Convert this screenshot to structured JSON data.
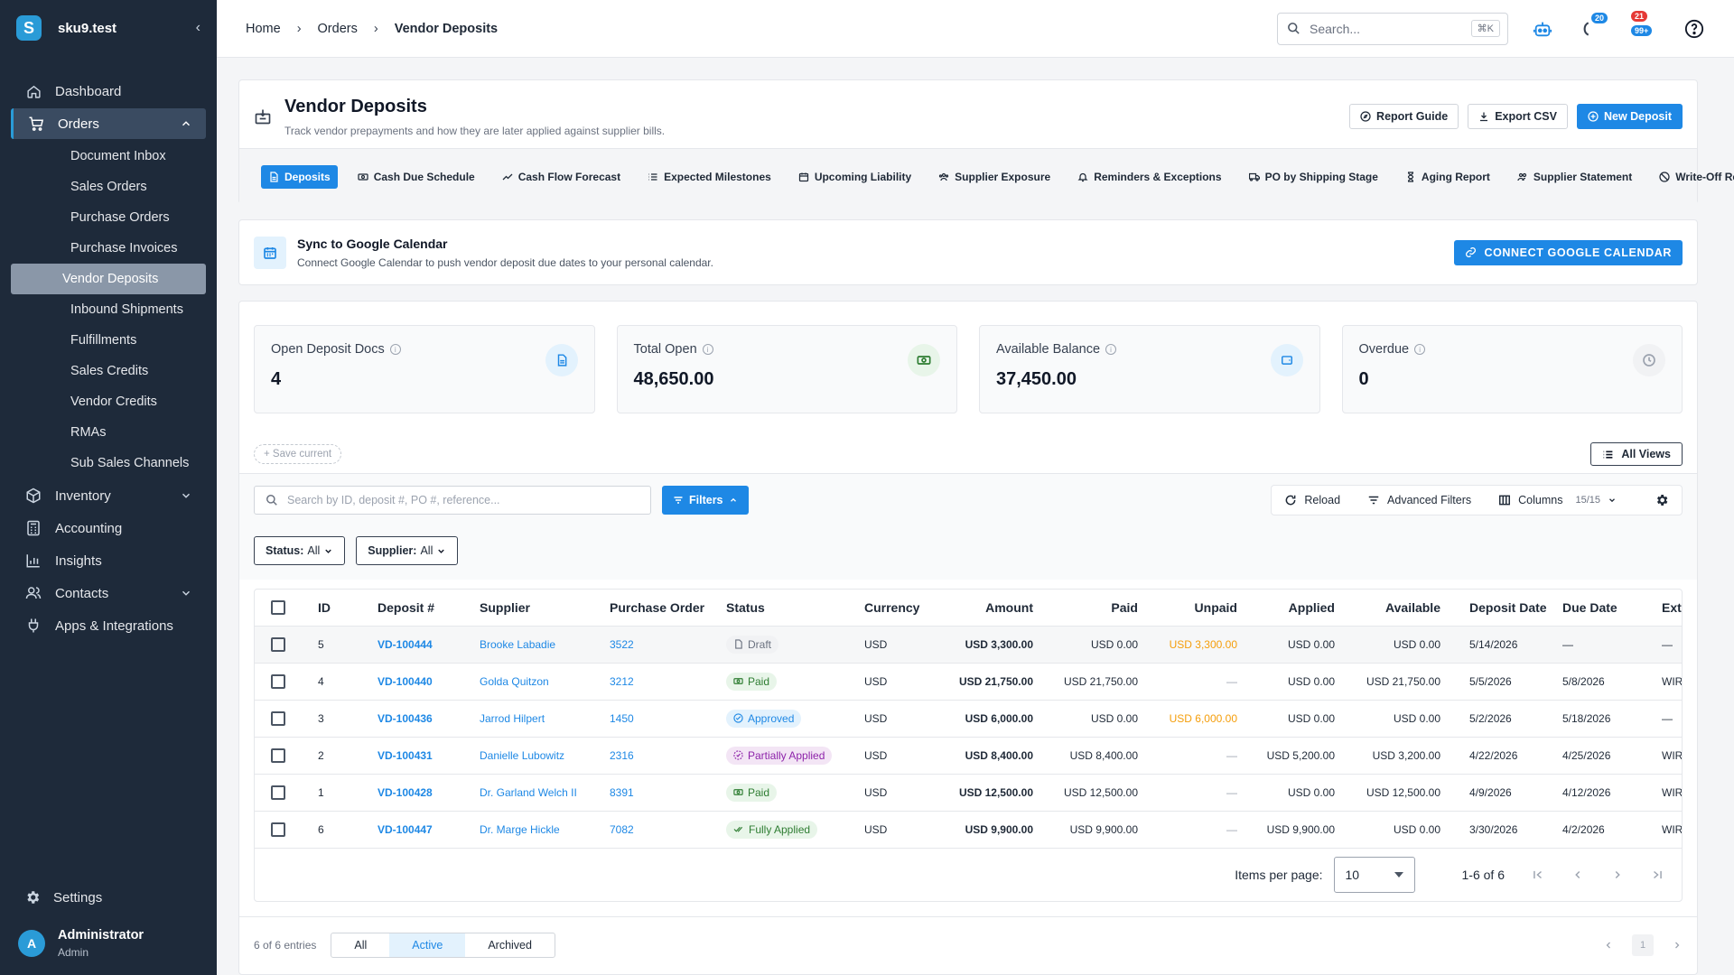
{
  "sidebar": {
    "brand": "sku9.test",
    "nav": {
      "dashboard": "Dashboard",
      "orders": "Orders",
      "inventory": "Inventory",
      "accounting": "Accounting",
      "insights": "Insights",
      "contacts": "Contacts",
      "apps": "Apps & Integrations"
    },
    "orders_sub": [
      "Document Inbox",
      "Sales Orders",
      "Purchase Orders",
      "Purchase Invoices",
      "Vendor Deposits",
      "Inbound Shipments",
      "Fulfillments",
      "Sales Credits",
      "Vendor Credits",
      "RMAs",
      "Sub Sales Channels"
    ],
    "settings": "Settings",
    "user": {
      "initial": "A",
      "name": "Administrator",
      "role": "Admin"
    }
  },
  "topbar": {
    "breadcrumb": [
      "Home",
      "Orders",
      "Vendor Deposits"
    ],
    "search_placeholder": "Search...",
    "search_shortcut": "⌘K",
    "badge_1": "20",
    "badge_2a": "21",
    "badge_2b": "99+"
  },
  "page": {
    "title": "Vendor Deposits",
    "subtitle": "Track vendor prepayments and how they are later applied against supplier bills.",
    "actions": {
      "guide": "Report Guide",
      "export": "Export CSV",
      "new": "New Deposit"
    },
    "tabs": [
      "Deposits",
      "Cash Due Schedule",
      "Cash Flow Forecast",
      "Expected Milestones",
      "Upcoming Liability",
      "Supplier Exposure",
      "Reminders & Exceptions",
      "PO by Shipping Stage",
      "Aging Report",
      "Supplier Statement",
      "Write-Off Report"
    ]
  },
  "sync": {
    "title": "Sync to Google Calendar",
    "subtitle": "Connect Google Calendar to push vendor deposit due dates to your personal calendar.",
    "button": "CONNECT GOOGLE CALENDAR"
  },
  "stats": [
    {
      "label": "Open Deposit Docs",
      "value": "4",
      "color": "#1e88e5",
      "bg": "#e3f2fd"
    },
    {
      "label": "Total Open",
      "value": "48,650.00",
      "color": "#2e7d32",
      "bg": "#e8f5e9"
    },
    {
      "label": "Available Balance",
      "value": "37,450.00",
      "color": "#1e88e5",
      "bg": "#e3f2fd"
    },
    {
      "label": "Overdue",
      "value": "0",
      "color": "#9ca3af",
      "bg": "#f1f2f4"
    }
  ],
  "views": {
    "save_current": "Save current",
    "all_views": "All Views"
  },
  "filters": {
    "search_placeholder": "Search by ID, deposit #, PO #, reference...",
    "filters_btn": "Filters",
    "reload": "Reload",
    "advanced": "Advanced Filters",
    "columns": "Columns",
    "columns_count": "15/15",
    "status_label": "Status:",
    "status_value": "All",
    "supplier_label": "Supplier:",
    "supplier_value": "All"
  },
  "table": {
    "headers": [
      "ID",
      "Deposit #",
      "Supplier",
      "Purchase Order",
      "Status",
      "Currency",
      "Amount",
      "Paid",
      "Unpaid",
      "Applied",
      "Available",
      "Deposit Date",
      "Due Date",
      "Ext."
    ],
    "rows": [
      {
        "id": "5",
        "deposit": "VD-100444",
        "supplier": "Brooke Labadie",
        "po": "3522",
        "status": "Draft",
        "status_kind": "draft",
        "currency": "USD",
        "amount": "USD 3,300.00",
        "paid": "USD 0.00",
        "unpaid": "USD 3,300.00",
        "applied": "USD 0.00",
        "available": "USD 0.00",
        "deposit_date": "5/14/2026",
        "due_date": "—",
        "ext": "—"
      },
      {
        "id": "4",
        "deposit": "VD-100440",
        "supplier": "Golda Quitzon",
        "po": "3212",
        "status": "Paid",
        "status_kind": "paid",
        "currency": "USD",
        "amount": "USD 21,750.00",
        "paid": "USD 21,750.00",
        "unpaid": "—",
        "applied": "USD 0.00",
        "available": "USD 21,750.00",
        "deposit_date": "5/5/2026",
        "due_date": "5/8/2026",
        "ext": "WIR"
      },
      {
        "id": "3",
        "deposit": "VD-100436",
        "supplier": "Jarrod Hilpert",
        "po": "1450",
        "status": "Approved",
        "status_kind": "approved",
        "currency": "USD",
        "amount": "USD 6,000.00",
        "paid": "USD 0.00",
        "unpaid": "USD 6,000.00",
        "applied": "USD 0.00",
        "available": "USD 0.00",
        "deposit_date": "5/2/2026",
        "due_date": "5/18/2026",
        "ext": "—"
      },
      {
        "id": "2",
        "deposit": "VD-100431",
        "supplier": "Danielle Lubowitz",
        "po": "2316",
        "status": "Partially Applied",
        "status_kind": "partial",
        "currency": "USD",
        "amount": "USD 8,400.00",
        "paid": "USD 8,400.00",
        "unpaid": "—",
        "applied": "USD 5,200.00",
        "available": "USD 3,200.00",
        "deposit_date": "4/22/2026",
        "due_date": "4/25/2026",
        "ext": "WIR"
      },
      {
        "id": "1",
        "deposit": "VD-100428",
        "supplier": "Dr. Garland Welch II",
        "po": "8391",
        "status": "Paid",
        "status_kind": "paid",
        "currency": "USD",
        "amount": "USD 12,500.00",
        "paid": "USD 12,500.00",
        "unpaid": "—",
        "applied": "USD 0.00",
        "available": "USD 12,500.00",
        "deposit_date": "4/9/2026",
        "due_date": "4/12/2026",
        "ext": "WIR"
      },
      {
        "id": "6",
        "deposit": "VD-100447",
        "supplier": "Dr. Marge Hickle",
        "po": "7082",
        "status": "Fully Applied",
        "status_kind": "full",
        "currency": "USD",
        "amount": "USD 9,900.00",
        "paid": "USD 9,900.00",
        "unpaid": "—",
        "applied": "USD 9,900.00",
        "available": "USD 0.00",
        "deposit_date": "3/30/2026",
        "due_date": "4/2/2026",
        "ext": "WIR"
      }
    ]
  },
  "pager": {
    "items_per_page_label": "Items per page:",
    "items_per_page": "10",
    "range": "1-6 of 6"
  },
  "footer": {
    "entries": "6 of 6 entries",
    "segments": [
      "All",
      "Active",
      "Archived"
    ],
    "page": "1"
  }
}
